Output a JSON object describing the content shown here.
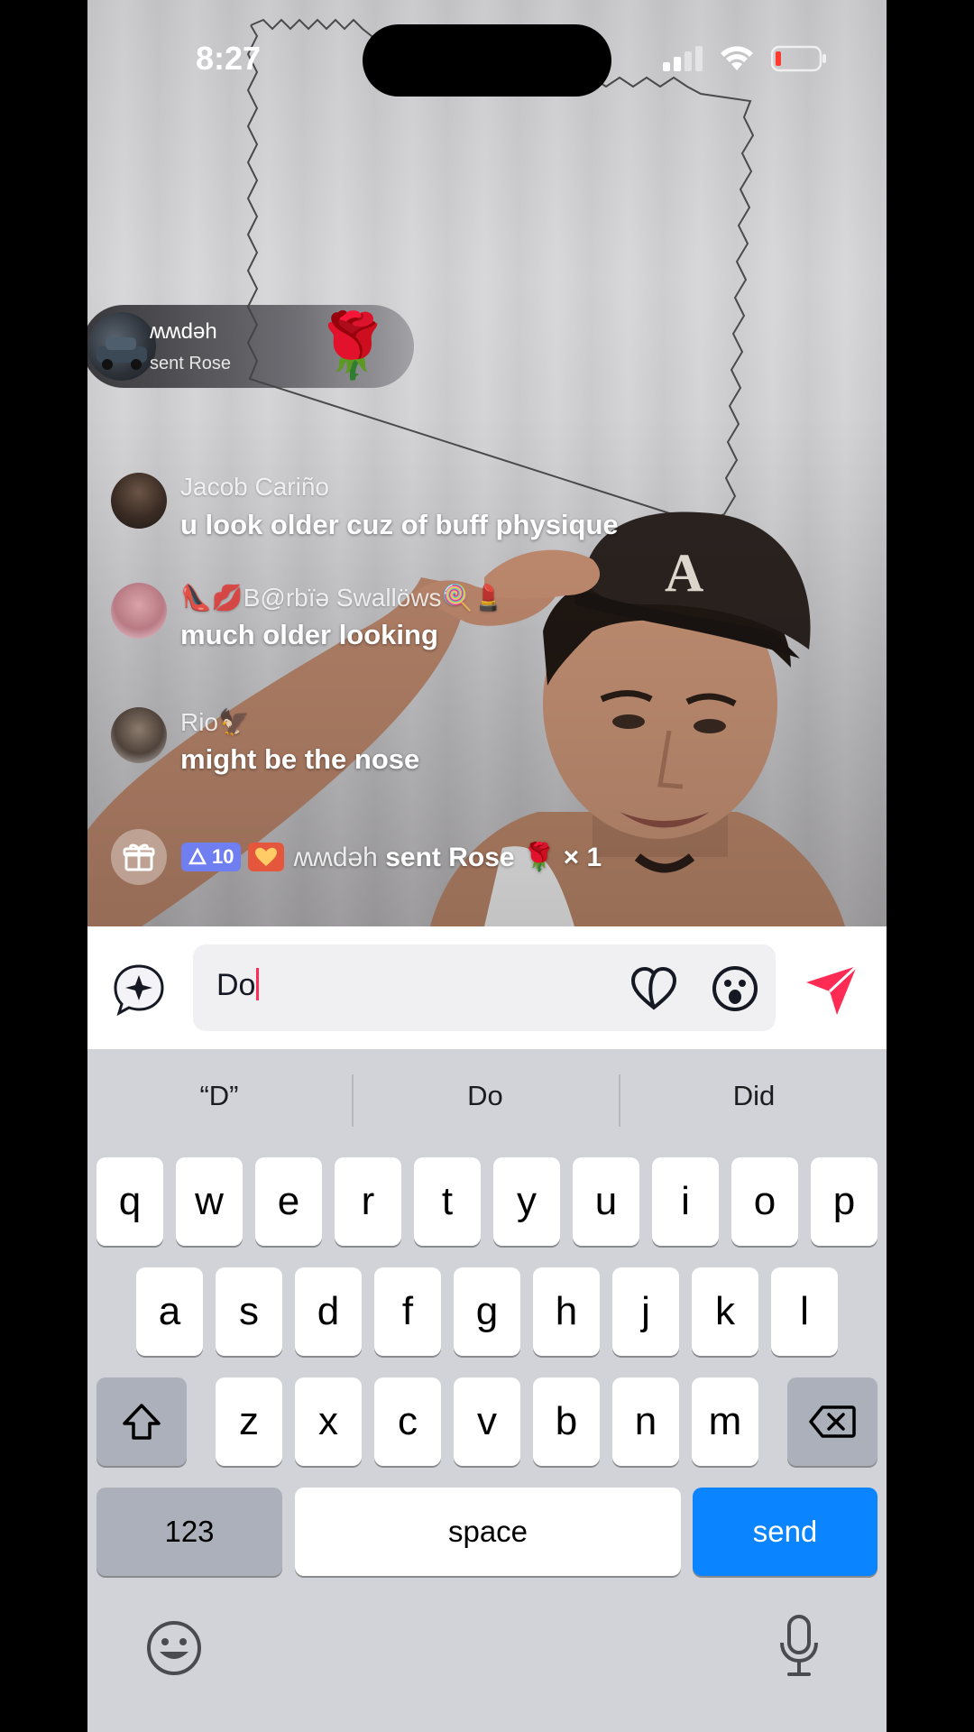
{
  "status_bar": {
    "time": "8:27"
  },
  "gift_banner": {
    "username": "ʍʍdəh",
    "action": "sent Rose",
    "gift_emoji": "🌹"
  },
  "comments": [
    {
      "name": "Jacob Cariño",
      "text": "u look older cuz of buff physique"
    },
    {
      "name": "👠💋B@rbïə Swallöws🍭💄",
      "text": "much older looking"
    },
    {
      "name": "Rio🦅",
      "text": "might be the nose"
    }
  ],
  "gift_line": {
    "level": "10",
    "username": "ʍʍdəh",
    "action": "sent Rose",
    "gift_emoji": "🌹",
    "count": "× 1"
  },
  "input": {
    "value": "Do"
  },
  "suggestions": [
    "“D”",
    "Do",
    "Did"
  ],
  "keyboard": {
    "row1": [
      "q",
      "w",
      "e",
      "r",
      "t",
      "y",
      "u",
      "i",
      "o",
      "p"
    ],
    "row2": [
      "a",
      "s",
      "d",
      "f",
      "g",
      "h",
      "j",
      "k",
      "l"
    ],
    "row3": [
      "z",
      "x",
      "c",
      "v",
      "b",
      "n",
      "m"
    ],
    "numbers_label": "123",
    "space_label": "space",
    "send_label": "send"
  },
  "colors": {
    "accent": "#fe2c55",
    "keyboard_send": "#0a84ff",
    "keyboard_bg": "#d1d3d9"
  },
  "icons": [
    "signal-icon",
    "wifi-icon",
    "battery-icon",
    "gift-icon",
    "sparkle-icon",
    "heart-icon",
    "emoji-icon",
    "send-arrow-icon",
    "shift-icon",
    "backspace-icon",
    "keyboard-emoji-icon",
    "microphone-icon"
  ]
}
